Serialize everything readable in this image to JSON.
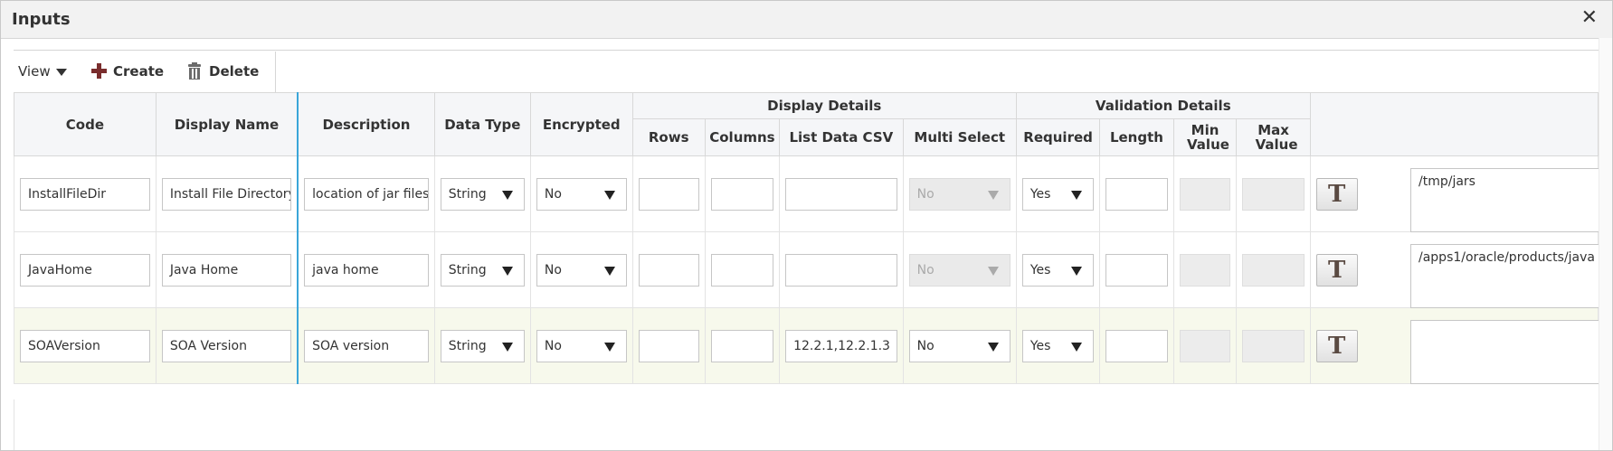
{
  "dialog": {
    "title": "Inputs",
    "close_label": "✕"
  },
  "toolbar": {
    "view_label": "View",
    "create_label": "Create",
    "delete_label": "Delete"
  },
  "headers": {
    "code": "Code",
    "display_name": "Display Name",
    "description": "Description",
    "data_type": "Data Type",
    "encrypted": "Encrypted",
    "display_details": "Display Details",
    "rows": "Rows",
    "columns": "Columns",
    "list_data_csv": "List Data CSV",
    "multi_select": "Multi Select",
    "validation_details": "Validation Details",
    "required": "Required",
    "length": "Length",
    "min_value": "Min Value",
    "max_value": "Max Value"
  },
  "rows": [
    {
      "code": "InstallFileDir",
      "display_name": "Install File Directory",
      "description": "location of jar files",
      "data_type": "String",
      "encrypted": "No",
      "rows": "",
      "columns": "",
      "list_data_csv": "",
      "multi_select": "No",
      "required": "Yes",
      "length": "",
      "min_value": "",
      "max_value": "",
      "type_button": "T",
      "value": "/tmp/jars"
    },
    {
      "code": "JavaHome",
      "display_name": "Java Home",
      "description": "java home",
      "data_type": "String",
      "encrypted": "No",
      "rows": "",
      "columns": "",
      "list_data_csv": "",
      "multi_select": "No",
      "required": "Yes",
      "length": "",
      "min_value": "",
      "max_value": "",
      "type_button": "T",
      "value": "/apps1/oracle/products/java"
    },
    {
      "code": "SOAVersion",
      "display_name": "SOA Version",
      "description": "SOA version",
      "data_type": "String",
      "encrypted": "No",
      "rows": "",
      "columns": "",
      "list_data_csv": "12.2.1,12.2.1.3",
      "multi_select": "No",
      "required": "Yes",
      "length": "",
      "min_value": "",
      "max_value": "",
      "type_button": "T",
      "value": ""
    }
  ]
}
